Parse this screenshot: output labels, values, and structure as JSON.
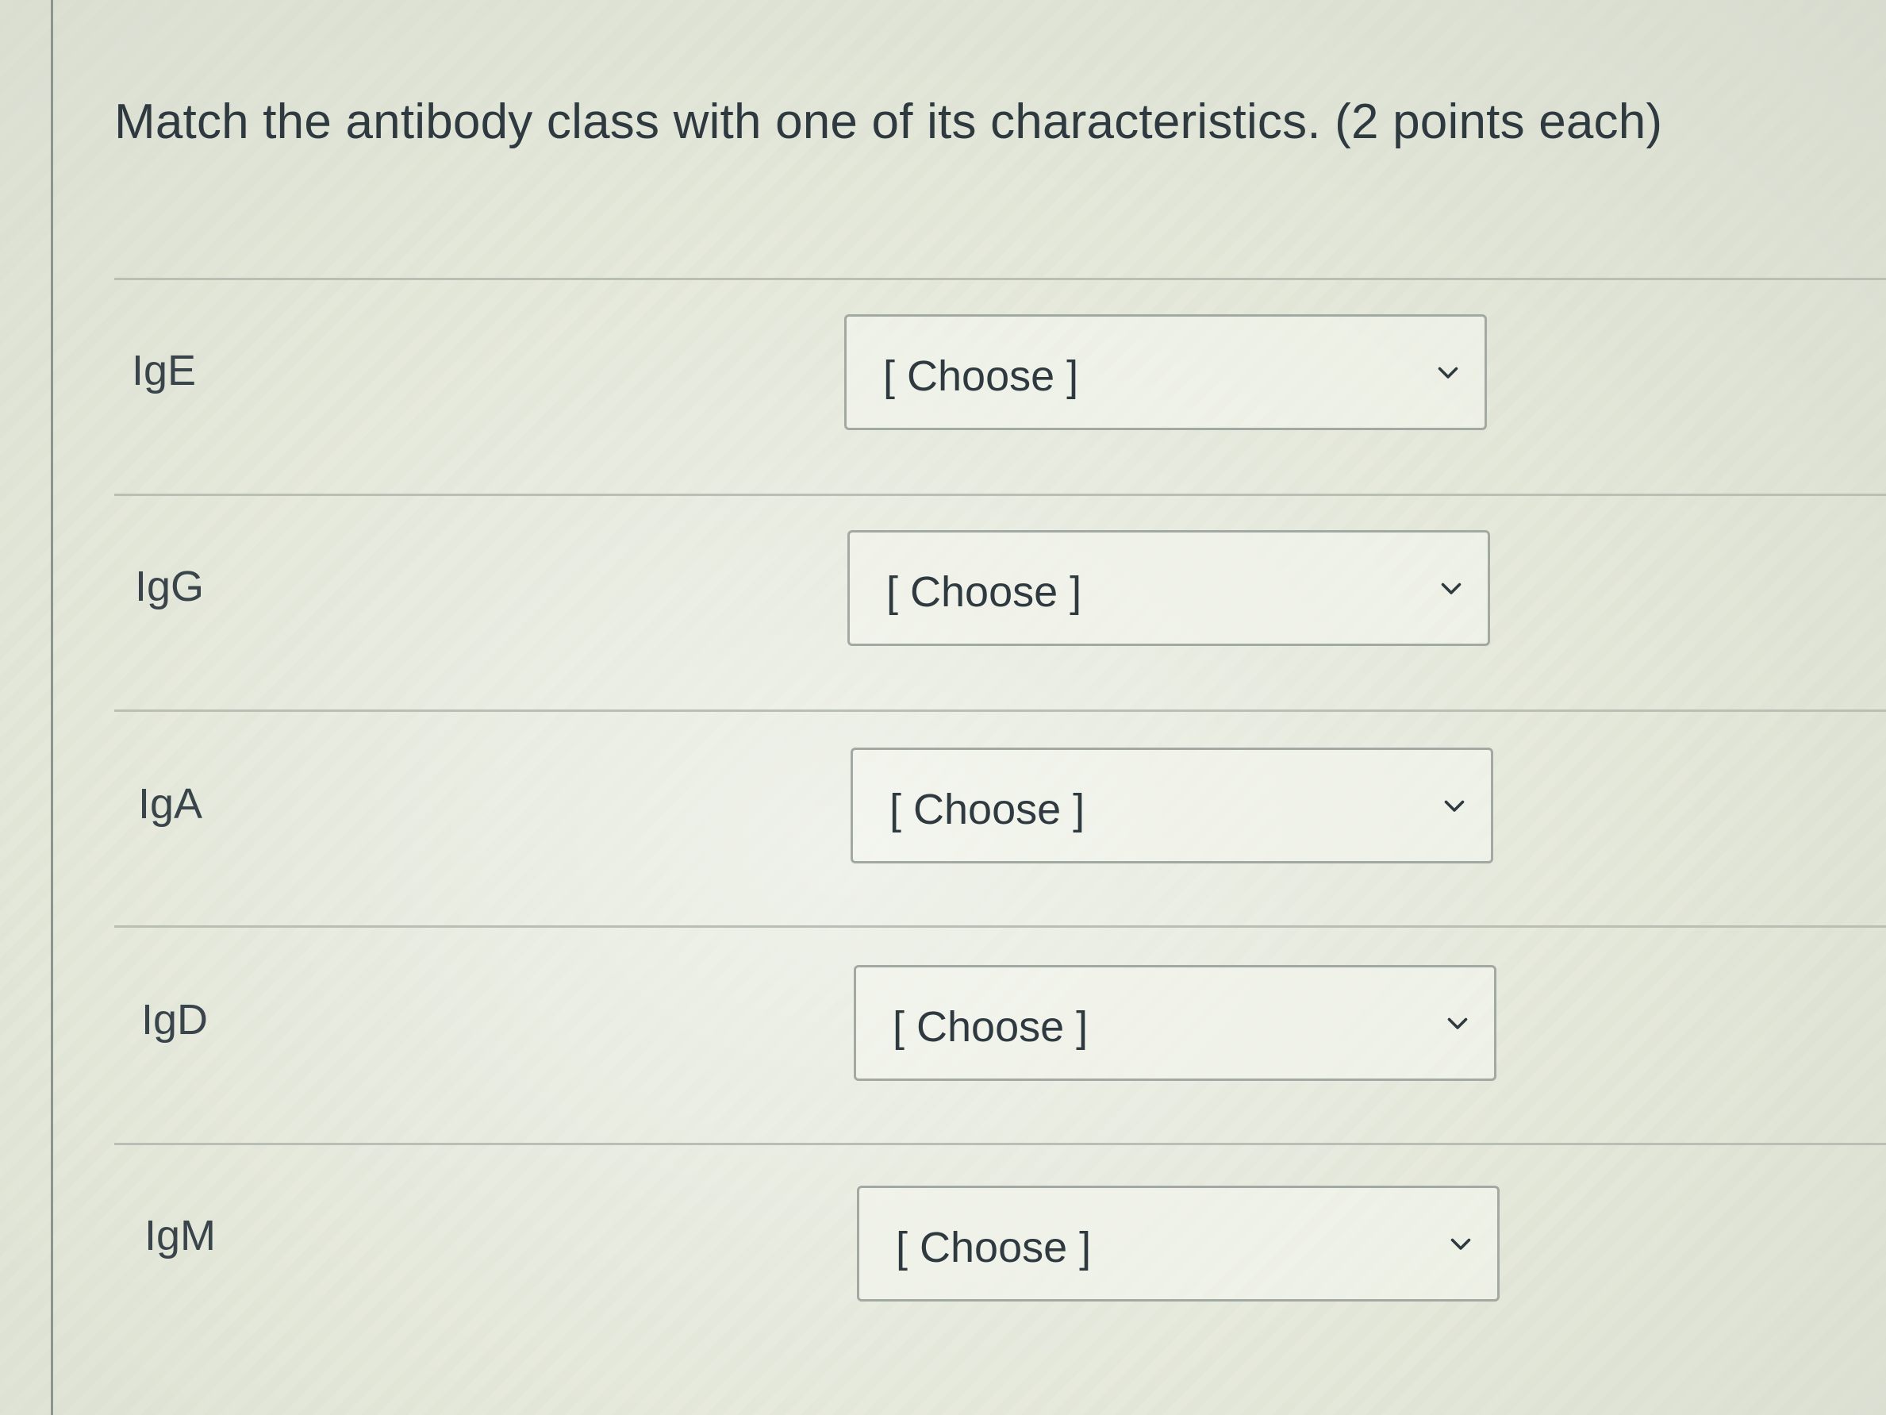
{
  "question": {
    "title": "Match the antibody class with one of its characteristics.  (2 points each)"
  },
  "rows": [
    {
      "label": "IgE",
      "selected": "[ Choose ]"
    },
    {
      "label": "IgG",
      "selected": "[ Choose ]"
    },
    {
      "label": "IgA",
      "selected": "[ Choose ]"
    },
    {
      "label": "IgD",
      "selected": "[ Choose ]"
    },
    {
      "label": "IgM",
      "selected": "[ Choose ]"
    }
  ],
  "icons": {
    "dropdown": "chevron-down-icon"
  }
}
